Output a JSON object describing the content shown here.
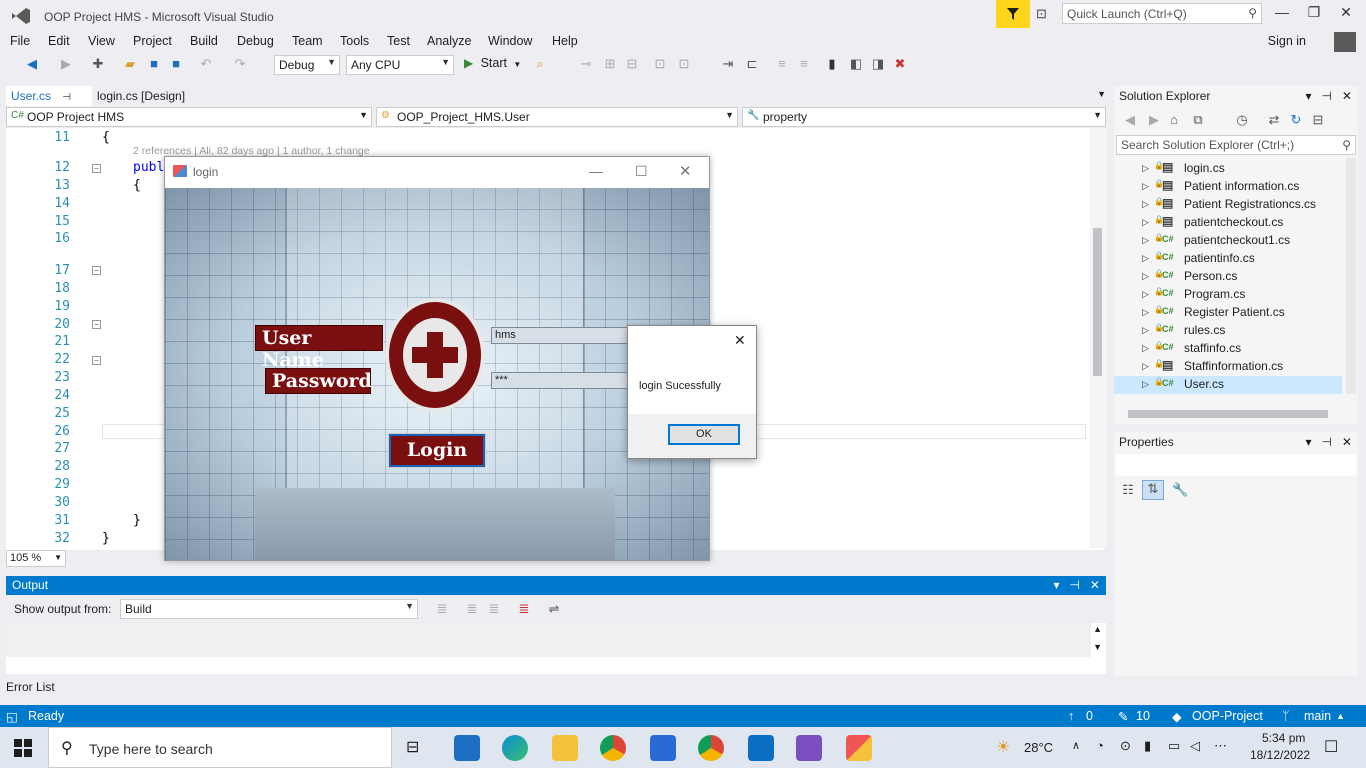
{
  "titlebar": {
    "title": "OOP Project HMS - Microsoft Visual Studio",
    "quick_launch_placeholder": "Quick Launch (Ctrl+Q)"
  },
  "menu": [
    "File",
    "Edit",
    "View",
    "Project",
    "Build",
    "Debug",
    "Team",
    "Tools",
    "Test",
    "Analyze",
    "Window",
    "Help"
  ],
  "signin": "Sign in",
  "toolbar": {
    "config": "Debug",
    "platform": "Any CPU",
    "start_label": "Start"
  },
  "doc_tabs": [
    {
      "label": "User.cs"
    },
    {
      "label": "login.cs [Design]"
    }
  ],
  "navbar": {
    "project": "OOP Project HMS",
    "class": "OOP_Project_HMS.User",
    "member": "property"
  },
  "editor": {
    "line_numbers": [
      "11",
      "12",
      "13",
      "14",
      "15",
      "16",
      "17",
      "18",
      "19",
      "20",
      "21",
      "22",
      "23",
      "24",
      "25",
      "26",
      "27",
      "28",
      "29",
      "30",
      "31",
      "32"
    ],
    "codelens": "2 references | Ali, 82 days ago | 1 author, 1 change",
    "code_11": "{",
    "code_12": "publ",
    "code_13": "{",
    "code_31": "}",
    "code_32": "}",
    "zoom": "105 %"
  },
  "login_form": {
    "title": "login",
    "username_label": "User Name",
    "password_label": "Password",
    "username_value": "hms",
    "password_value": "***",
    "login_button": "Login"
  },
  "msgbox": {
    "message": "login Sucessfully",
    "ok": "OK"
  },
  "output": {
    "title": "Output",
    "show_from_label": "Show output from:",
    "source": "Build"
  },
  "error_list": "Error List",
  "solution_explorer": {
    "title": "Solution Explorer",
    "search_placeholder": "Search Solution Explorer (Ctrl+;)",
    "items": [
      {
        "name": "login.cs",
        "type": "form"
      },
      {
        "name": "Patient information.cs",
        "type": "form"
      },
      {
        "name": "Patient Registrationcs.cs",
        "type": "form"
      },
      {
        "name": "patientcheckout.cs",
        "type": "form"
      },
      {
        "name": "patientcheckout1.cs",
        "type": "cs"
      },
      {
        "name": "patientinfo.cs",
        "type": "cs"
      },
      {
        "name": "Person.cs",
        "type": "cs"
      },
      {
        "name": "Program.cs",
        "type": "cs"
      },
      {
        "name": "Register Patient.cs",
        "type": "cs"
      },
      {
        "name": "rules.cs",
        "type": "cs"
      },
      {
        "name": "staffinfo.cs",
        "type": "cs"
      },
      {
        "name": "Staffinformation.cs",
        "type": "form"
      },
      {
        "name": "User.cs",
        "type": "cs",
        "selected": true
      }
    ]
  },
  "properties": {
    "title": "Properties"
  },
  "statusbar": {
    "ready": "Ready",
    "up": "0",
    "edits": "10",
    "repo": "OOP-Project",
    "branch": "main"
  },
  "taskbar": {
    "search_placeholder": "Type here to search",
    "temp": "28°C",
    "time": "5:34 pm",
    "date": "18/12/2022"
  }
}
